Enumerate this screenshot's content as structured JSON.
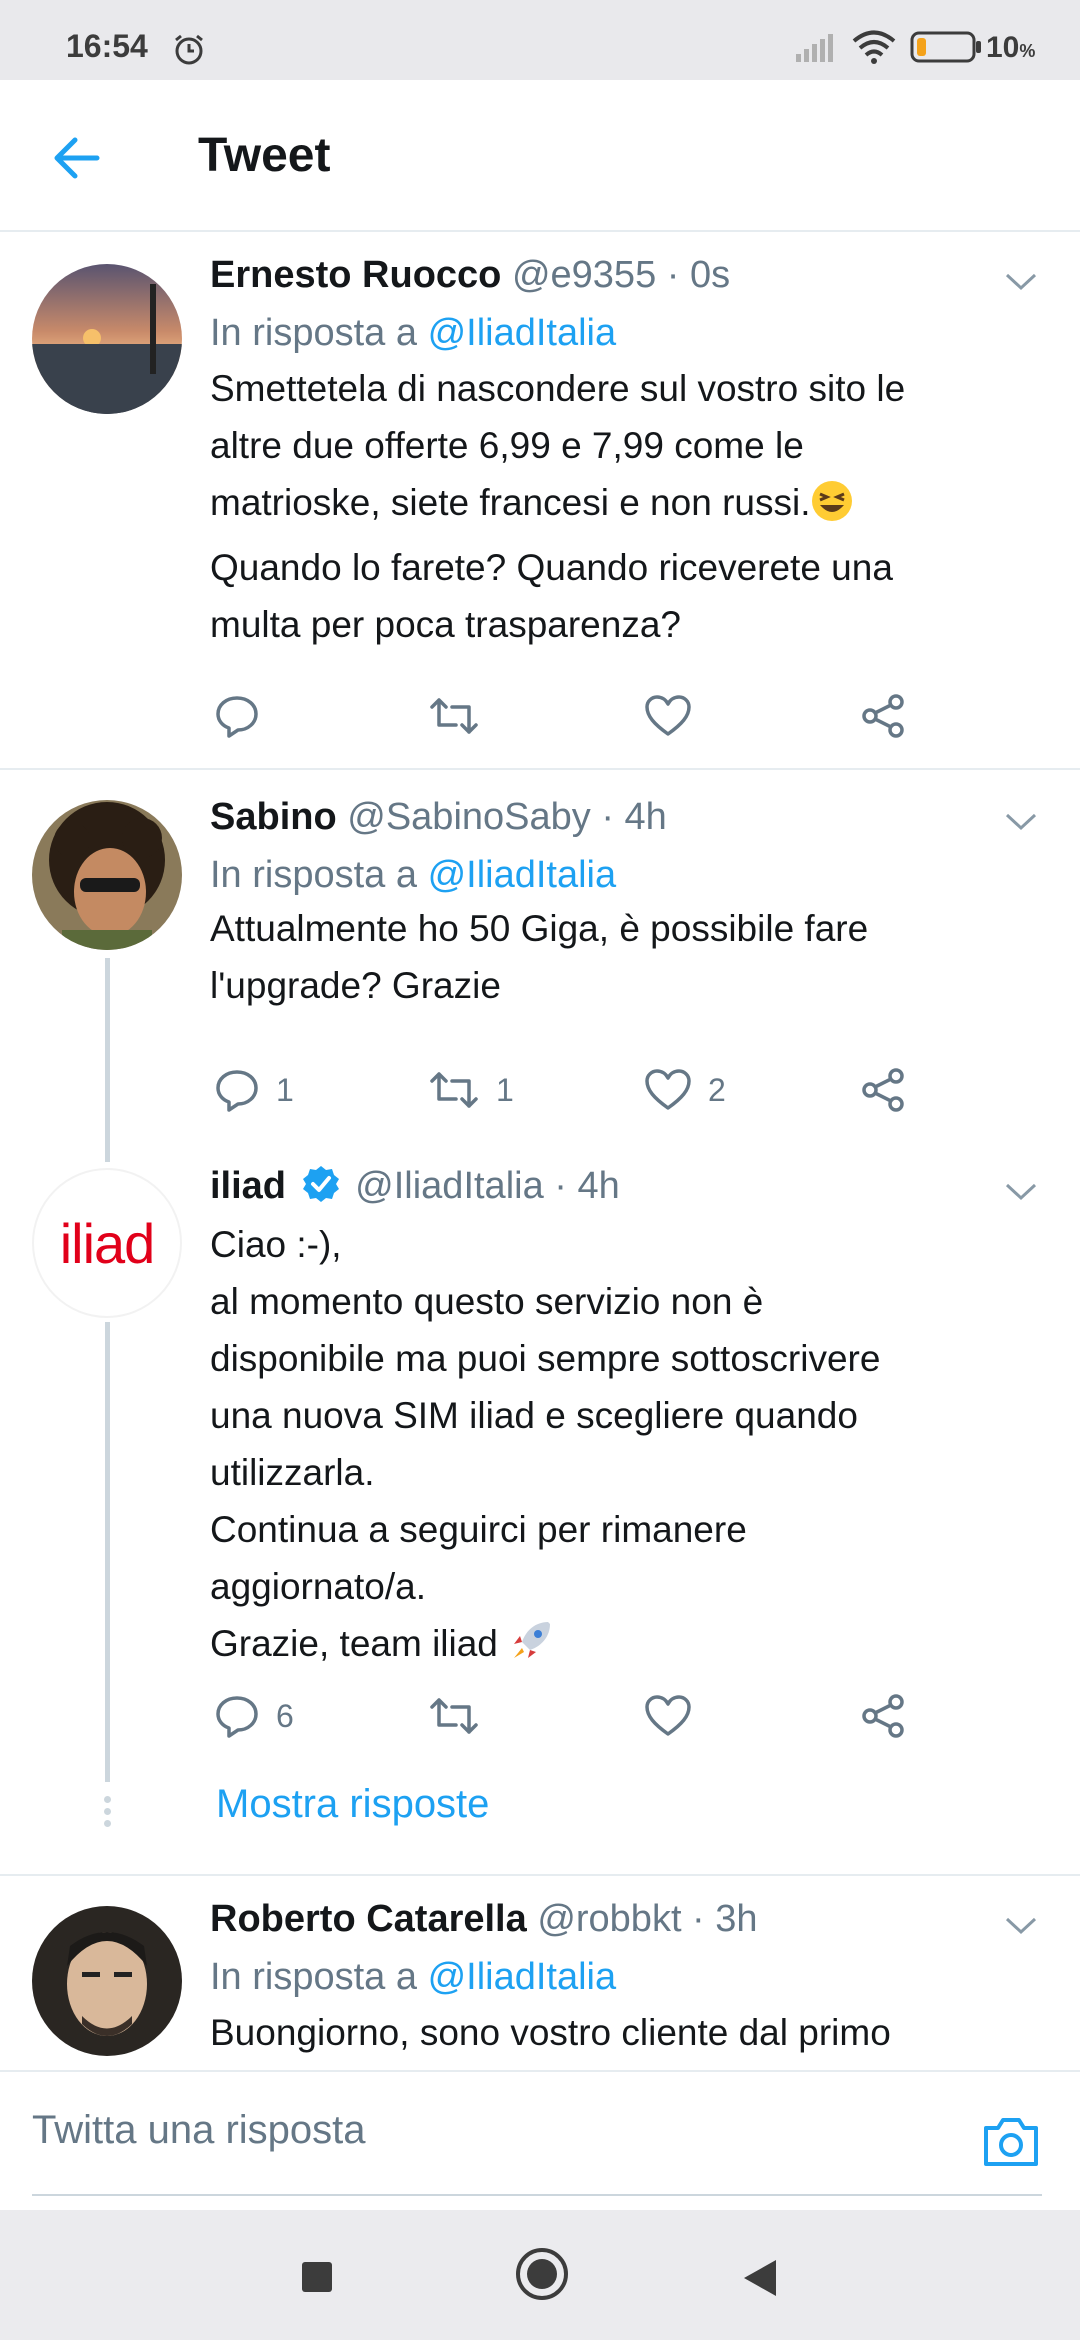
{
  "status_bar": {
    "time": "16:54",
    "battery_percent": "10",
    "battery_unit": "%",
    "icons": [
      "alarm-icon",
      "signal-icon",
      "wifi-icon",
      "battery-icon"
    ]
  },
  "header": {
    "title": "Tweet",
    "back_icon": "arrow-left-icon"
  },
  "colors": {
    "accent": "#1da1f2",
    "text": "#14171a",
    "secondary": "#657786",
    "divider": "#e6ecf0",
    "iliad_red": "#e1001a"
  },
  "tweets": [
    {
      "name": "Ernesto Ruocco",
      "meta": "@e9355 · 0s",
      "reply_prefix": "In risposta a ",
      "reply_handle": "@IliadItalia",
      "lines": [
        "Smettetela di nascondere sul vostro sito le",
        "altre due offerte 6,99 e 7,99 come le",
        "matrioske, siete francesi e non russi.",
        "Quando lo farete? Quando riceverete una",
        "multa per poca trasparenza?"
      ],
      "emoji": "grinning-squinting-face-emoji",
      "counts": {
        "reply": "",
        "retweet": "",
        "like": ""
      }
    },
    {
      "name": "Sabino",
      "meta": "@SabinoSaby · 4h",
      "reply_prefix": "In risposta a ",
      "reply_handle": "@IliadItalia",
      "lines": [
        "Attualmente ho 50 Giga, è possibile fare",
        "l'upgrade? Grazie"
      ],
      "counts": {
        "reply": "1",
        "retweet": "1",
        "like": "2"
      }
    },
    {
      "name": "iliad",
      "verified": true,
      "meta": "@IliadItalia · 4h",
      "avatar_text": "iliad",
      "lines": [
        "Ciao :-),",
        "al momento questo servizio non è",
        "disponibile ma puoi sempre sottoscrivere",
        "una nuova SIM iliad e scegliere quando",
        "utilizzarla.",
        "Continua a seguirci per rimanere",
        "aggiornato/a.",
        "Grazie, team iliad"
      ],
      "emoji": "rocket-emoji",
      "counts": {
        "reply": "6",
        "retweet": "",
        "like": ""
      },
      "show_replies": "Mostra risposte"
    },
    {
      "name": "Roberto Catarella",
      "meta": "@robbkt · 3h",
      "reply_prefix": "In risposta a ",
      "reply_handle": "@IliadItalia",
      "lines": [
        "Buongiorno, sono vostro cliente dal primo"
      ]
    }
  ],
  "reply_bar": {
    "placeholder": "Twitta una risposta",
    "camera_icon": "camera-icon"
  },
  "nav_bar": {
    "icons": [
      "recent-apps-icon",
      "home-icon",
      "back-icon"
    ]
  }
}
